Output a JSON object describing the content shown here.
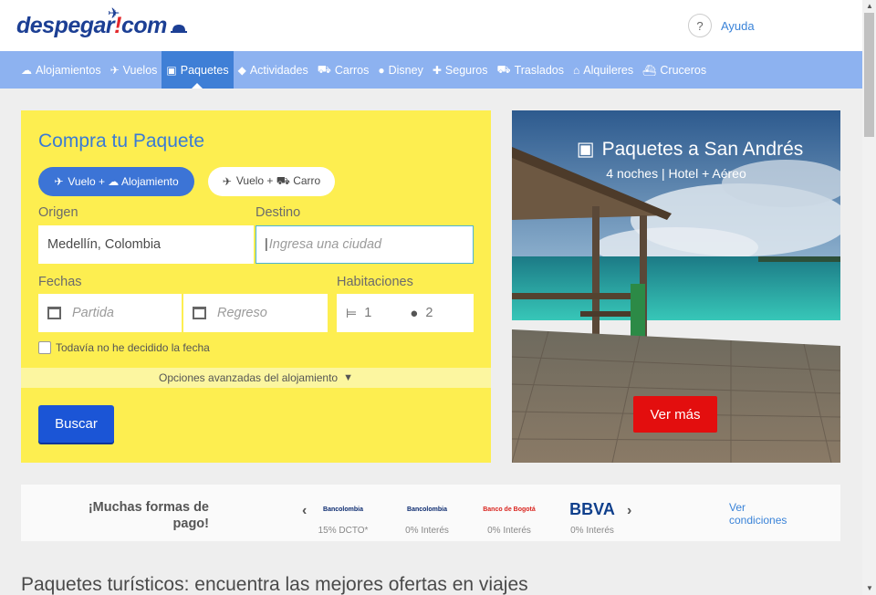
{
  "header": {
    "logo_text": "despegar",
    "logo_suffix": "com",
    "help_symbol": "?",
    "help_label": "Ayuda"
  },
  "nav": [
    {
      "label": "Alojamientos",
      "icon": "hotel-icon"
    },
    {
      "label": "Vuelos",
      "icon": "plane-icon"
    },
    {
      "label": "Paquetes",
      "icon": "suitcase-icon",
      "active": true
    },
    {
      "label": "Actividades",
      "icon": "tag-icon"
    },
    {
      "label": "Carros",
      "icon": "car-icon"
    },
    {
      "label": "Disney",
      "icon": "mickey-icon"
    },
    {
      "label": "Seguros",
      "icon": "medical-case-icon"
    },
    {
      "label": "Traslados",
      "icon": "shuttle-icon"
    },
    {
      "label": "Alquileres",
      "icon": "house-icon"
    },
    {
      "label": "Cruceros",
      "icon": "cruise-icon"
    }
  ],
  "search": {
    "title": "Compra tu Paquete",
    "option_a": "Vuelo + ☁ Alojamiento",
    "option_b": "Vuelo + ⛟ Carro",
    "origin_label": "Origen",
    "origin_value": "Medellín, Colombia",
    "dest_label": "Destino",
    "dest_placeholder": "Ingresa una ciudad",
    "dates_label": "Fechas",
    "depart_placeholder": "Partida",
    "return_placeholder": "Regreso",
    "rooms_label": "Habitaciones",
    "rooms_value": "1",
    "guests_value": "2",
    "undecided_label": "Todavía no he decidido la fecha",
    "advanced_label": "Opciones avanzadas del alojamiento",
    "search_button": "Buscar"
  },
  "promo": {
    "title": "Paquetes a San Andrés",
    "subtitle": "4 noches | Hotel + Aéreo",
    "button": "Ver más"
  },
  "payment": {
    "title_line1": "¡Muchas formas de",
    "title_line2": "pago!",
    "banks": [
      {
        "logo": "Bancolombia",
        "caption": "15% DCTO*"
      },
      {
        "logo": "Bancolombia",
        "caption": "0% Interés"
      },
      {
        "logo": "Banco de Bogotá",
        "caption": "0% Interés"
      },
      {
        "logo": "BBVA",
        "caption": "0% Interés"
      }
    ],
    "conditions_line1": "Ver",
    "conditions_line2": "condiciones"
  },
  "bottom_heading": "Paquetes turísticos: encuentra las mejores ofertas en viajes"
}
